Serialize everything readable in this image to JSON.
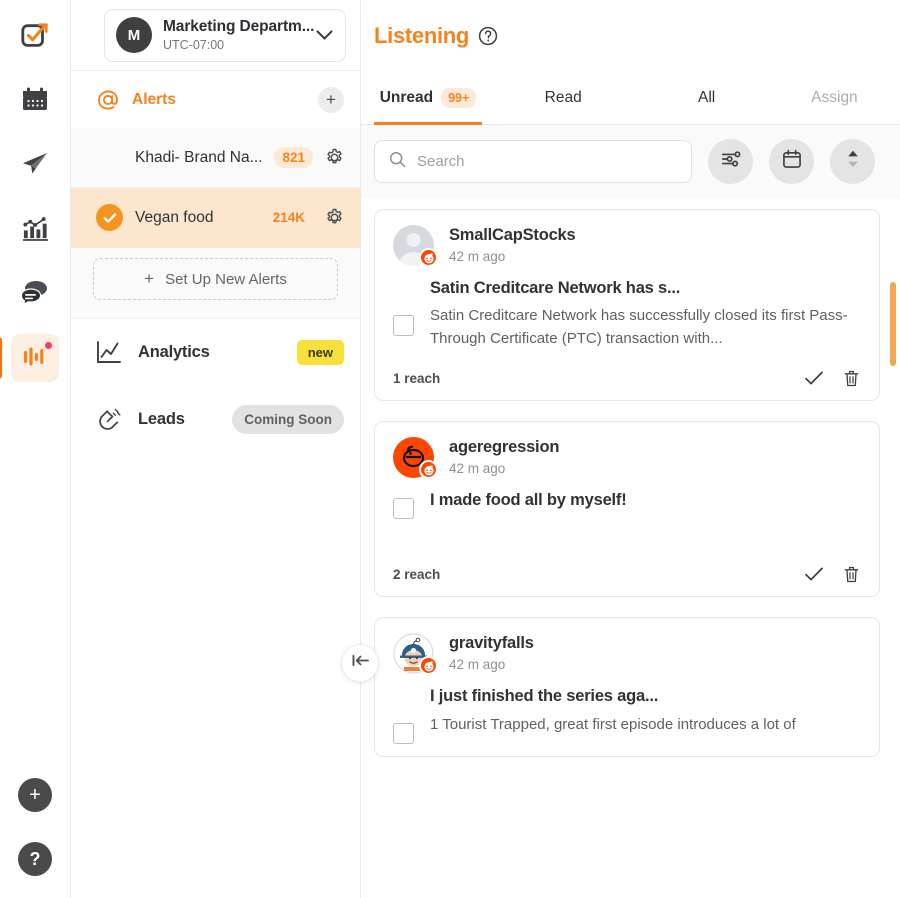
{
  "rail": {
    "items": [
      {
        "name": "tasks-icon",
        "label": "Tasks"
      },
      {
        "name": "calendar-icon",
        "label": "Calendar"
      },
      {
        "name": "publish-icon",
        "label": "Publish"
      },
      {
        "name": "analytics-icon",
        "label": "Analytics"
      },
      {
        "name": "engage-icon",
        "label": "Engage"
      },
      {
        "name": "listening-icon",
        "label": "Listening"
      }
    ],
    "add_label": "+",
    "help_label": "?"
  },
  "org": {
    "avatar_initial": "M",
    "name": "Marketing Departm...",
    "timezone": "UTC-07:00"
  },
  "sidebar": {
    "alerts_title": "Alerts",
    "add_alert_label": "+",
    "alerts": [
      {
        "name": "Khadi- Brand Na...",
        "count": "821",
        "selected": false,
        "pill": true
      },
      {
        "name": "Vegan food",
        "count": "214K",
        "selected": true,
        "pill": false
      }
    ],
    "new_alert_label": "Set Up New Alerts",
    "new_alert_plus": "+",
    "nav": [
      {
        "label": "Analytics",
        "badge": "new",
        "badge_kind": "new"
      },
      {
        "label": "Leads",
        "badge": "Coming Soon",
        "badge_kind": "soon"
      }
    ],
    "collapse_label": "Collapse sidebar"
  },
  "main": {
    "title": "Listening",
    "tabs": [
      {
        "label": "Unread",
        "badge": "99+",
        "active": true,
        "disabled": false
      },
      {
        "label": "Read",
        "badge": "",
        "active": false,
        "disabled": false
      },
      {
        "label": "All",
        "badge": "",
        "active": false,
        "disabled": false
      },
      {
        "label": "Assign",
        "badge": "",
        "active": false,
        "disabled": true
      }
    ],
    "search": {
      "placeholder": "Search",
      "value": ""
    },
    "toolbar": [
      {
        "name": "filter-icon",
        "label": "Filter"
      },
      {
        "name": "calendar-icon",
        "label": "Date range"
      },
      {
        "name": "sort-icon",
        "label": "Sort"
      }
    ]
  },
  "posts": [
    {
      "username": "SmallCapStocks",
      "time": "42 m ago",
      "avatar_kind": "placeholder",
      "source": "reddit",
      "title": "Satin Creditcare Network has s...",
      "excerpt": "Satin Creditcare Network has successfully closed its first Pass-Through Certificate (PTC) transaction with...",
      "reach": "1 reach",
      "has_excerpt": true
    },
    {
      "username": "ageregression",
      "time": "42 m ago",
      "avatar_kind": "ageregression",
      "source": "reddit",
      "title": "I made food all by myself!",
      "excerpt": "",
      "reach": "2 reach",
      "has_excerpt": false
    },
    {
      "username": "gravityfalls",
      "time": "42 m ago",
      "avatar_kind": "gravityfalls",
      "source": "reddit",
      "title": "I just finished the series aga...",
      "excerpt": "1 Tourist Trapped, great first episode introduces a lot of",
      "reach": "",
      "has_excerpt": true
    }
  ],
  "colors": {
    "accent": "#f5821f",
    "reddit": "#ff4500",
    "badge_new": "#f7e03a",
    "selected_row": "#fce6cd",
    "scrollbar": "#f3a658"
  }
}
